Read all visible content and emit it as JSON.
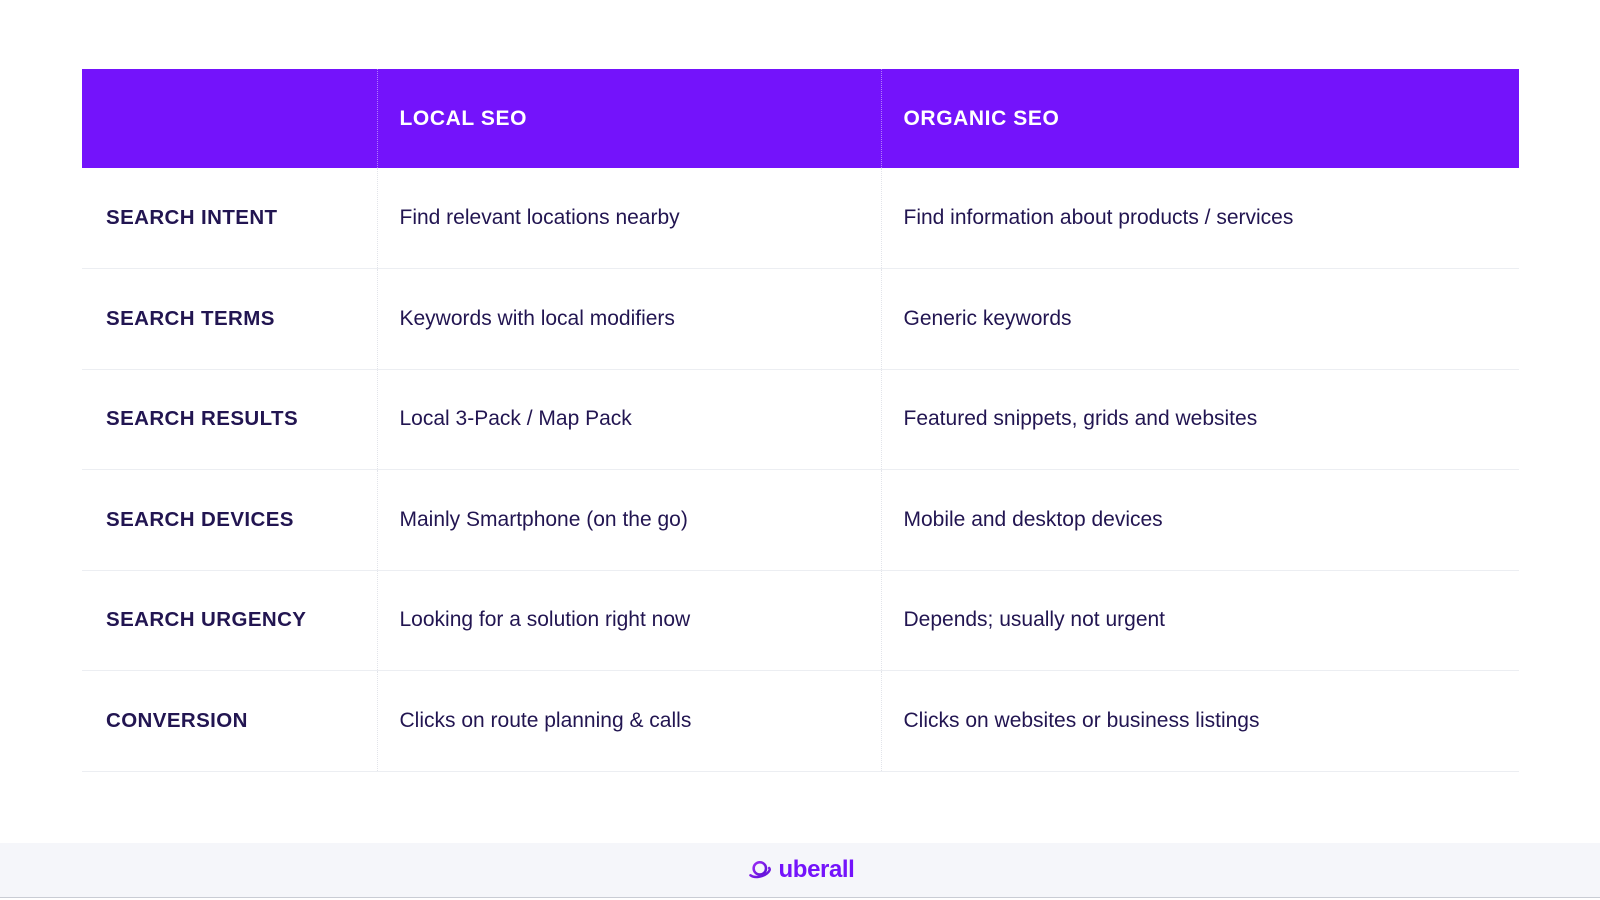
{
  "colors": {
    "header_purple": "#7413FB",
    "text_navy": "#221551",
    "row_divider": "#ECEEF2",
    "column_divider": "#E2E4EA",
    "footer_band": "#F5F6FA",
    "brand_purple": "#7413FB"
  },
  "table": {
    "headers": {
      "label_column": "",
      "local": "LOCAL SEO",
      "organic": "ORGANIC SEO"
    },
    "rows": [
      {
        "label": "SEARCH INTENT",
        "local": "Find relevant locations nearby",
        "organic": "Find information about products / services"
      },
      {
        "label": "SEARCH TERMS",
        "local": "Keywords with local modifiers",
        "organic": "Generic keywords"
      },
      {
        "label": "SEARCH RESULTS",
        "local": "Local 3-Pack / Map Pack",
        "organic": "Featured snippets, grids and websites"
      },
      {
        "label": "SEARCH DEVICES",
        "local": "Mainly Smartphone (on the go)",
        "organic": "Mobile and desktop devices"
      },
      {
        "label": "SEARCH URGENCY",
        "local": "Looking for a solution right now",
        "organic": "Depends; usually not urgent"
      },
      {
        "label": "CONVERSION",
        "local": "Clicks on route planning & calls",
        "organic": "Clicks on websites or business listings"
      }
    ]
  },
  "footer": {
    "brand_name": "uberall",
    "brand_icon": "saturn-planet-icon"
  }
}
